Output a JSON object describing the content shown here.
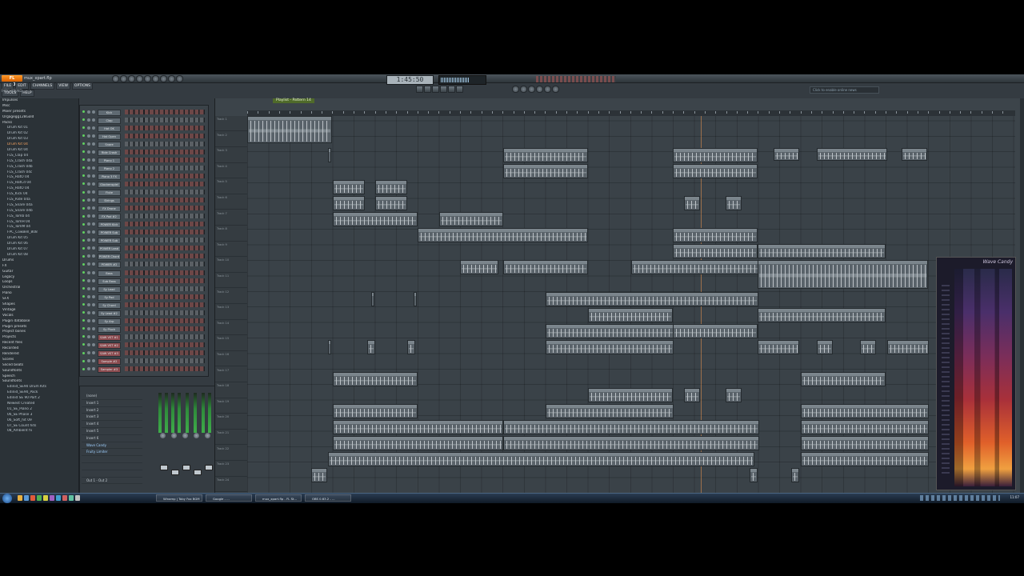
{
  "window": {
    "app_logo": "FL STUDIO",
    "file_name": "mux_xpart.flp",
    "tempo": "1:45:50",
    "hint_text": "PITCHBEND",
    "menu": [
      "FILE",
      "EDIT",
      "CHANNELS",
      "VIEW",
      "OPTIONS",
      "TOOLS",
      "HELP"
    ],
    "hint_bar": "Click to enable online news"
  },
  "browser": {
    "items": [
      {
        "label": "Impulses",
        "type": "folder"
      },
      {
        "label": "Misc",
        "type": "folder"
      },
      {
        "label": "Mixer presets",
        "type": "folder"
      },
      {
        "label": "Orgagegg128Gold",
        "type": "folder"
      },
      {
        "label": "Packs",
        "type": "folder"
      },
      {
        "label": "Drum Kit 01",
        "type": "item"
      },
      {
        "label": "Drum Kit 02",
        "type": "item"
      },
      {
        "label": "Drum Kit 03",
        "type": "item"
      },
      {
        "label": "Drum Kit 04",
        "type": "open"
      },
      {
        "label": "Drum Kit 04",
        "type": "item"
      },
      {
        "label": "FLS_Clap 04",
        "type": "item"
      },
      {
        "label": "FLS_Crash 04a",
        "type": "item"
      },
      {
        "label": "FLS_Crash 04b",
        "type": "item"
      },
      {
        "label": "FLS_Crash 04c",
        "type": "item"
      },
      {
        "label": "FLS_HatO 04",
        "type": "item"
      },
      {
        "label": "FLS_HatCd 04",
        "type": "item"
      },
      {
        "label": "FLS_HatO 04",
        "type": "item"
      },
      {
        "label": "FLS_Kick 04",
        "type": "item"
      },
      {
        "label": "FLS_Ride 04a",
        "type": "item"
      },
      {
        "label": "FLS_Snare 04a",
        "type": "item"
      },
      {
        "label": "FLS_Snare 04b",
        "type": "item"
      },
      {
        "label": "FLS_Tomb 04",
        "type": "item"
      },
      {
        "label": "FLS_TomH 04",
        "type": "item"
      },
      {
        "label": "FLS_TomM 04",
        "type": "item"
      },
      {
        "label": "FPC_CowBell_808",
        "type": "item"
      },
      {
        "label": "Drum Kit 05",
        "type": "item"
      },
      {
        "label": "Drum Kit 06",
        "type": "item"
      },
      {
        "label": "Drum Kit 07",
        "type": "item"
      },
      {
        "label": "Drum Kit 08",
        "type": "item"
      },
      {
        "label": "Drums",
        "type": "folder"
      },
      {
        "label": "FX",
        "type": "folder"
      },
      {
        "label": "Guitar",
        "type": "folder"
      },
      {
        "label": "Legacy",
        "type": "folder"
      },
      {
        "label": "Loops",
        "type": "folder"
      },
      {
        "label": "Orchestral",
        "type": "folder"
      },
      {
        "label": "Piano",
        "type": "folder"
      },
      {
        "label": "SFX",
        "type": "folder"
      },
      {
        "label": "Shapes",
        "type": "folder"
      },
      {
        "label": "Vintage",
        "type": "folder"
      },
      {
        "label": "Vocals",
        "type": "folder"
      },
      {
        "label": "Plugin database",
        "type": "folder"
      },
      {
        "label": "Plugin presets",
        "type": "folder"
      },
      {
        "label": "Project bones",
        "type": "folder"
      },
      {
        "label": "Projects",
        "type": "folder"
      },
      {
        "label": "Recent files",
        "type": "folder"
      },
      {
        "label": "Recorded",
        "type": "folder"
      },
      {
        "label": "Rendered",
        "type": "folder"
      },
      {
        "label": "Scores",
        "type": "folder"
      },
      {
        "label": "Sliced beats",
        "type": "folder"
      },
      {
        "label": "Soundfonts",
        "type": "folder"
      },
      {
        "label": "Speech",
        "type": "folder"
      },
      {
        "label": "Soundfonts",
        "type": "folder"
      },
      {
        "label": "Edinid_SE90 Drum Kits",
        "type": "item"
      },
      {
        "label": "Edinid_SE90_Pack",
        "type": "item"
      },
      {
        "label": "Edinid SE 90 Part 2",
        "type": "item"
      },
      {
        "label": "Newest Created",
        "type": "item"
      },
      {
        "label": "01_SE_Piano 2",
        "type": "item"
      },
      {
        "label": "06_SE Phase 3",
        "type": "item"
      },
      {
        "label": "06_Soft_hit 09",
        "type": "item"
      },
      {
        "label": "07_SE Count hits",
        "type": "item"
      },
      {
        "label": "08_Ambient fx",
        "type": "item"
      }
    ]
  },
  "rack": {
    "channels": [
      {
        "name": "Kick",
        "red": false
      },
      {
        "name": "Clap",
        "red": false
      },
      {
        "name": "Hat OK",
        "red": false
      },
      {
        "name": "Hat Open",
        "red": false
      },
      {
        "name": "Snare",
        "red": false
      },
      {
        "name": "Ride Crash",
        "red": false
      },
      {
        "name": "Piano 1",
        "red": false
      },
      {
        "name": "Piano 2",
        "red": false
      },
      {
        "name": "Piano 3 FX",
        "red": false
      },
      {
        "name": "Glockenspiel",
        "red": false
      },
      {
        "name": "Flute",
        "red": false
      },
      {
        "name": "Strings",
        "red": false
      },
      {
        "name": "FX Drone",
        "red": false
      },
      {
        "name": "FX Pad #2",
        "red": false
      },
      {
        "name": "POWER Kick",
        "red": false
      },
      {
        "name": "POWER Sub",
        "red": false
      },
      {
        "name": "POWER Sub",
        "red": false
      },
      {
        "name": "POWER Lead",
        "red": false
      },
      {
        "name": "POWER Chord",
        "red": false
      },
      {
        "name": "POWER #2",
        "red": false
      },
      {
        "name": "Bass",
        "red": false
      },
      {
        "name": "Sub Bass",
        "red": false
      },
      {
        "name": "Sy Lead",
        "red": false
      },
      {
        "name": "Sy Pad",
        "red": false
      },
      {
        "name": "Sy Chord",
        "red": false
      },
      {
        "name": "Sy Lead #2",
        "red": false
      },
      {
        "name": "Sy Arp",
        "red": false
      },
      {
        "name": "Sy Pluck",
        "red": false
      },
      {
        "name": "SAW VST #1",
        "red": true
      },
      {
        "name": "SAW VST #2",
        "red": true
      },
      {
        "name": "SAW VST #3",
        "red": true
      },
      {
        "name": "Sample #2",
        "red": true
      },
      {
        "name": "Sampler #3",
        "red": true
      }
    ]
  },
  "mixer": {
    "items": [
      {
        "label": "(none)",
        "hl": false
      },
      {
        "label": "Insert 1",
        "hl": false
      },
      {
        "label": "Insert 2",
        "hl": false
      },
      {
        "label": "Insert 3",
        "hl": false
      },
      {
        "label": "Insert 4",
        "hl": false
      },
      {
        "label": "Insert 5",
        "hl": false
      },
      {
        "label": "Insert 6",
        "hl": false
      },
      {
        "label": "Wave Candy",
        "hl": true
      },
      {
        "label": "Fruity Limiter",
        "hl": true
      },
      {
        "label": "",
        "hl": false
      },
      {
        "label": "",
        "hl": false
      },
      {
        "label": "",
        "hl": false
      },
      {
        "label": "Out 1 - Out 2",
        "hl": false
      }
    ]
  },
  "playlist": {
    "title": "Playlist - Pattern 14",
    "track_labels": [
      "Track 1",
      "Track 2",
      "Track 3",
      "Track 4",
      "Track 5",
      "Track 6",
      "Track 7",
      "Track 8",
      "Track 9",
      "Track 10",
      "Track 11",
      "Track 12",
      "Track 13",
      "Track 14",
      "Track 15",
      "Track 16",
      "Track 17",
      "Track 18",
      "Track 19",
      "Track 20",
      "Track 21",
      "Track 22",
      "Track 23",
      "Track 24"
    ]
  },
  "plugin": {
    "title": "Wave Candy"
  },
  "taskbar": {
    "buttons": [
      "Winamp | Toby Fox BGM",
      "Google - ...",
      "mux_xpart.flp - FL St...",
      "OBS 0.63.2 - ..."
    ],
    "clock": "11:07"
  },
  "colors": {
    "accent": "#f08a2a",
    "playlist_bg": "#3a4248",
    "spectrum_hot": "#e0602a"
  }
}
